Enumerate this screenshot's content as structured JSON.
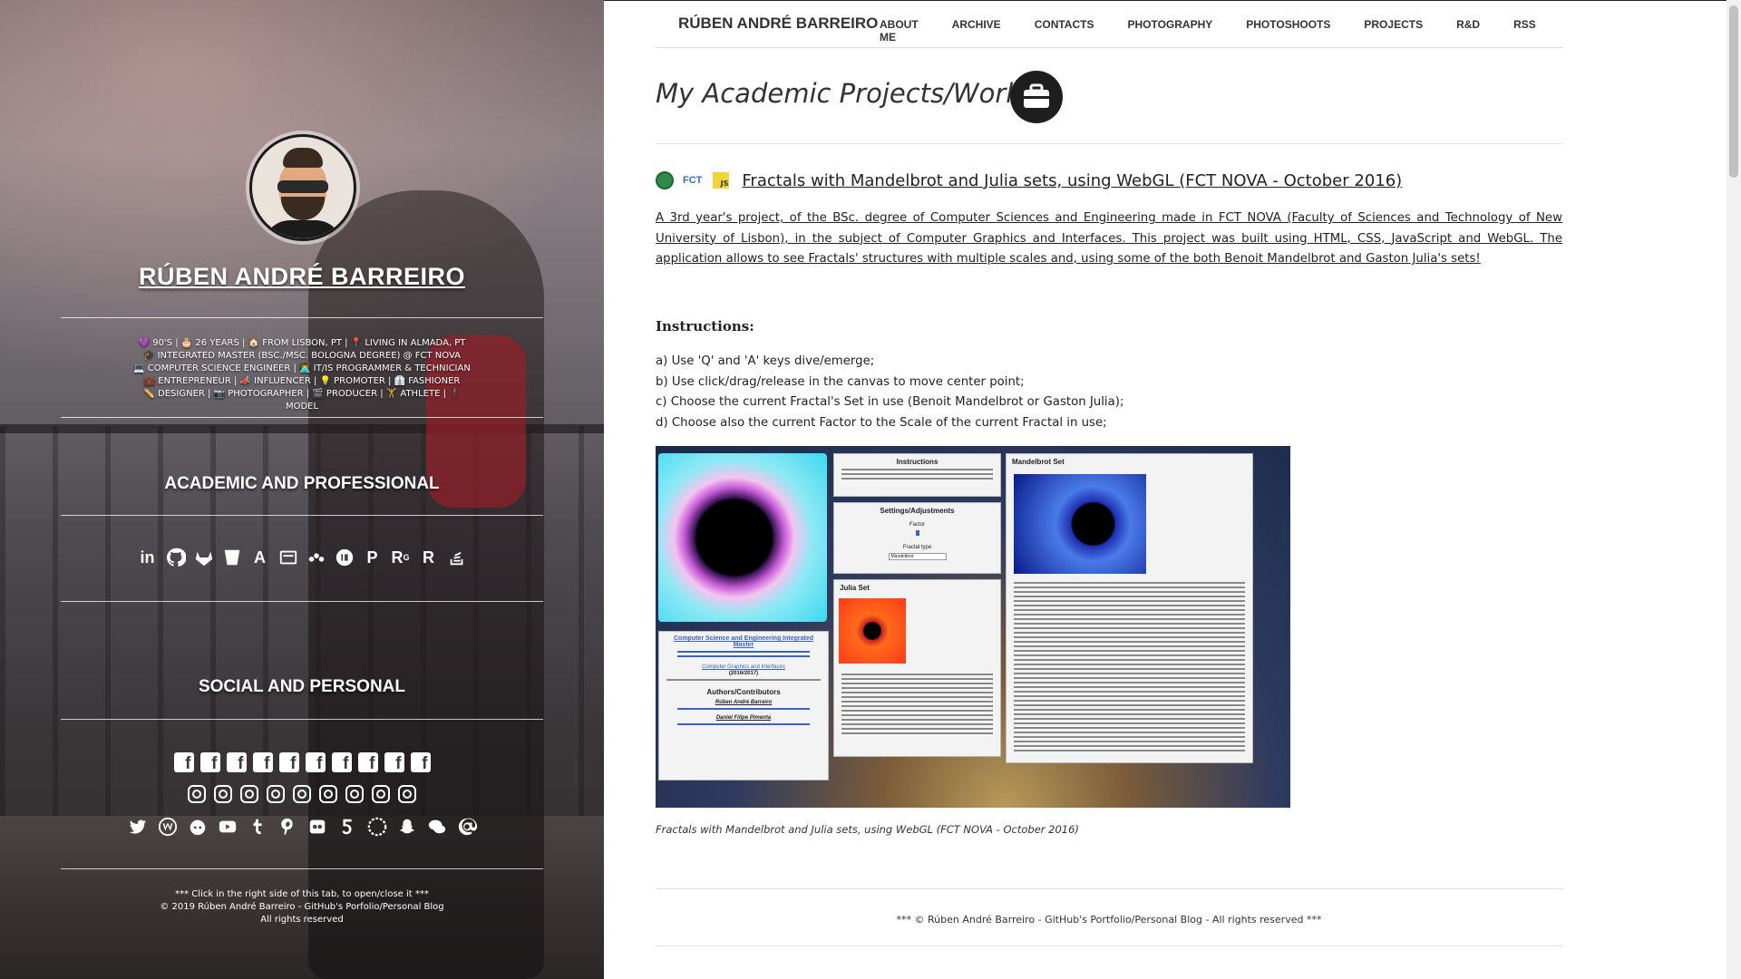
{
  "sidebar": {
    "name": "RÚBEN ANDRÉ BARREIRO",
    "tags_line1": "💜 90'S | 🎂 26 YEARS | 🏠 FROM LISBON, PT | 📍 LIVING IN ALMADA, PT",
    "tags_line2": "🎓 INTEGRATED MASTER (BSC./MSC. BOLOGNA DEGREE) @ FCT NOVA",
    "tags_line3": "💻 COMPUTER SCIENCE ENGINEER | 👨‍💻 IT/IS PROGRAMMER & TECHNICIAN",
    "tags_line4": "💼 ENTREPRENEUR | 📣 INFLUENCER | 💡 PROMOTER | 👔 FASHIONER",
    "tags_line5": "✏️ DESIGNER | 📷 PHOTOGRAPHER | 🎬 PRODUCER | 🏋️ ATHLETE | 🕴 MODEL",
    "section_academic": "ACADEMIC AND PROFESSIONAL",
    "section_social": "SOCIAL AND PERSONAL",
    "academic_icons": {
      "linkedin": "in",
      "a_icon": "A",
      "p_icon": "P",
      "rg_icon": "R",
      "rg_sup": "G",
      "r_icon": "R"
    },
    "facebook_glyph": "f",
    "footer_line1": "*** Click in the right side of this tab, to open/close it ***",
    "footer_line2": "© 2019 Rúben André Barreiro - GitHub's Porfolio/Personal Blog",
    "footer_line3": "All rights reserved"
  },
  "nav": {
    "brand": "RÚBEN ANDRÉ BARREIRO",
    "links": [
      "ABOUT ME",
      "ARCHIVE",
      "CONTACTS",
      "PHOTOGRAPHY",
      "PHOTOSHOOTS",
      "PROJECTS",
      "R&D",
      "RSS"
    ]
  },
  "main": {
    "page_title": "My Academic Projects/Works",
    "project": {
      "fct_logo": "FCT",
      "js_logo": "JS",
      "title": "Fractals with Mandelbrot and Julia sets, using WebGL (FCT NOVA - October 2016)",
      "description": "A 3rd year's project, of the BSc. degree of Computer Sciences and Engineering made in FCT NOVA (Faculty of Sciences and Technology of New University of Lisbon), in the subject of Computer Graphics and Interfaces. This project was built using HTML, CSS, JavaScript and WebGL. The application allows to see Fractals' structures with multiple scales and, using some of the both Benoit Mandelbrot and Gaston Julia's sets!",
      "instructions_title": "Instructions:",
      "instructions": [
        "a) Use 'Q' and 'A' keys dive/emerge;",
        "b) Use click/drag/release in the canvas to move center point;",
        "c) Choose the current Fractal's Set in use (Benoit Mandelbrot or Gaston Julia);",
        "d) Choose also the current Factor to the Scale of the current Fractal in use;"
      ],
      "screenshot": {
        "instructions_header": "Instructions",
        "settings_header": "Settings/Adjustments",
        "settings_factor": "Factor",
        "settings_type": "Fractal type",
        "settings_select": "Mandelbrot",
        "mandelbrot_header": "Mandelbrot Set",
        "julia_header": "Julia Set",
        "info_title": "Computer Science and Engineering Integrated Master",
        "info_subtitle": "Computer Graphics and Interfaces",
        "info_year": "(2016/2017)",
        "authors_header": "Authors/Contributors",
        "author1": "Rúben André Barreiro",
        "author2": "Daniel Filipe Pimenta"
      },
      "caption": "Fractals with Mandelbrot and Julia sets, using WebGL (FCT NOVA - October 2016)"
    },
    "footer": "*** © Rúben André Barreiro - GitHub's Portfolio/Personal Blog - All rights reserved ***"
  },
  "colors": {
    "text": "#333333",
    "sidebar_text": "#ffffff",
    "js_yellow": "#f0d43a",
    "fct_blue": "#3a6fb8",
    "nova_green": "#2e8b4a"
  }
}
